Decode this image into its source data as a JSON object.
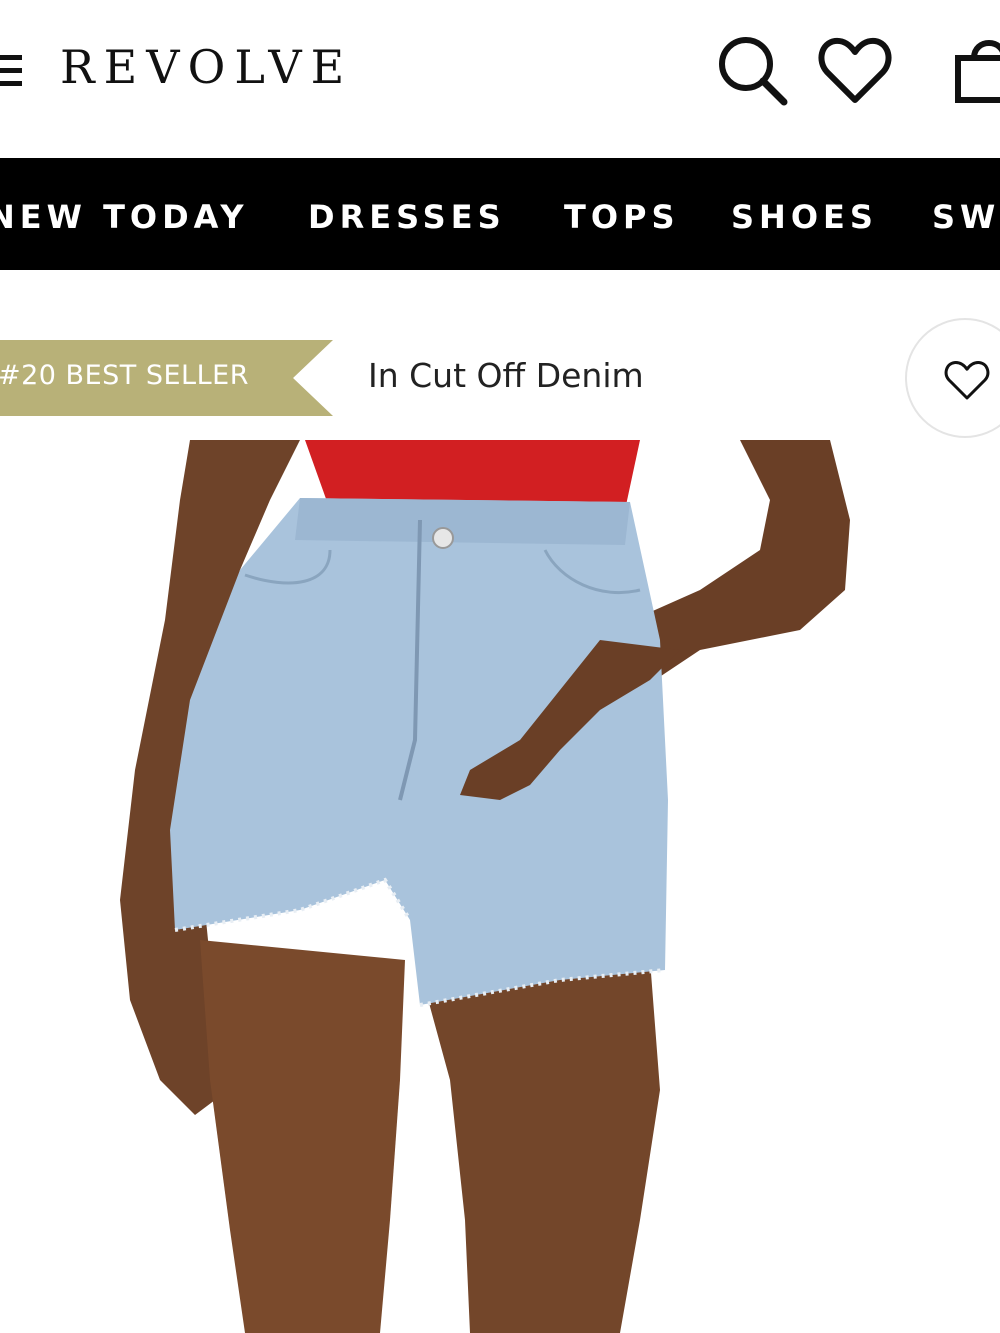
{
  "header": {
    "logo": "REVOLVE",
    "icons": [
      "menu-icon",
      "search-icon",
      "heart-icon",
      "bag-icon"
    ]
  },
  "nav": {
    "items": [
      "NEW TODAY",
      "DRESSES",
      "TOPS",
      "SHOES",
      "SW"
    ]
  },
  "product": {
    "badge": "#20 BEST SELLER",
    "name": "In Cut Off Denim",
    "colors": {
      "badge": "#b8b178",
      "denim": "#a9c3dc",
      "top": "#d21f22"
    }
  }
}
